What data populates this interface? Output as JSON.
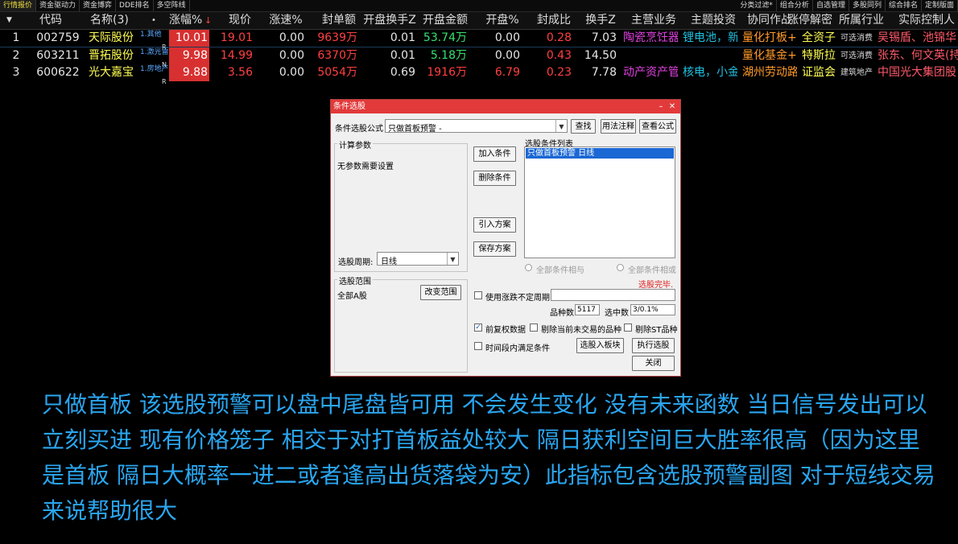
{
  "topbar": {
    "left_tabs": [
      "行情报价",
      "资金驱动力",
      "资金博弈",
      "DDE排名",
      "多空阵线"
    ],
    "right_tabs": [
      "分类过滤*",
      "组合分析",
      "自选管理",
      "多股同列",
      "综合排名",
      "定制版面"
    ]
  },
  "table": {
    "headers": {
      "idx": "▼",
      "code": "代码",
      "name": "名称(3)",
      "dot": "•",
      "chg": "涨幅%",
      "sort_arrow": "↓",
      "price": "现价",
      "speed": "涨速%",
      "seal": "封单额",
      "open_turn": "开盘换手Z",
      "open_amt": "开盘金额",
      "open_pct": "开盘%",
      "seal_ratio": "封成比",
      "turn": "换手Z",
      "business": "主营业务",
      "theme": "主题投资",
      "synergy": "协同作战",
      "reason": "涨停解密",
      "industry": "所属行业",
      "controller": "实际控制人"
    },
    "rows": [
      {
        "idx": "1",
        "code": "002759",
        "name": "天际股份",
        "tag": "1.其他",
        "N": "R",
        "chg": "10.01",
        "price": "19.01",
        "speed": "0.00",
        "seal": "9639万",
        "open_turn": "0.01",
        "open_amt": "53.74万",
        "open_pct": "0.00",
        "seal_ratio": "0.28",
        "turn": "7.03",
        "business": "陶瓷烹饪器",
        "theme": "锂电池，新",
        "synergy": "量化打板+",
        "reason": "全资子",
        "industry": "可选消费",
        "controller": "吴锡盾、池锦华"
      },
      {
        "idx": "2",
        "code": "603211",
        "name": "晋拓股份",
        "tag": "1.激光雷",
        "N": "N",
        "chg": "9.98",
        "price": "14.99",
        "speed": "0.00",
        "seal": "6370万",
        "open_turn": "0.01",
        "open_amt": "5.18万",
        "open_pct": "0.00",
        "seal_ratio": "0.43",
        "turn": "14.50",
        "business": "",
        "theme": "",
        "synergy": "量化基金+",
        "reason": "特斯拉",
        "industry": "可选消费",
        "controller": "张东、何文英(持"
      },
      {
        "idx": "3",
        "code": "600622",
        "name": "光大嘉宝",
        "tag": "1.房地产",
        "N": "R",
        "chg": "9.88",
        "price": "3.56",
        "speed": "0.00",
        "seal": "5054万",
        "open_turn": "0.69",
        "open_amt": "1916万",
        "open_pct": "6.79",
        "seal_ratio": "0.23",
        "turn": "7.78",
        "business": "动产资产管",
        "theme": "核电，小金",
        "synergy": "湖州劳动路",
        "reason": "证监会",
        "industry": "建筑地产",
        "controller": "中国光大集团股"
      }
    ]
  },
  "dialog": {
    "title": "条件选股",
    "formula_label": "条件选股公式",
    "formula_value": "只做首板预警 -",
    "find_button": "查找",
    "usage_button": "用法注释",
    "view_button": "查看公式",
    "params_group": "计算参数",
    "params_text": "无参数需要设置",
    "period_label": "选股周期:",
    "period_value": "日线",
    "add_button": "加入条件",
    "delete_button": "删除条件",
    "import_button": "引入方案",
    "save_button": "保存方案",
    "list_label": "选股条件列表",
    "list_item": "只做首板预警  日线",
    "and_label": "全部条件相与",
    "or_label": "全部条件相或",
    "done_status": "选股完毕.",
    "range_group": "选股范围",
    "range_value": "全部A股",
    "change_range_button": "改变范围",
    "use_period_label": "使用涨跌不定周期",
    "count_label": "品种数",
    "count_value": "5117",
    "selected_label": "选中数",
    "selected_value": "3/0.1%",
    "prerights_label": "前复权数据",
    "exclude_untraded_label": "剔除当前未交易的品种",
    "exclude_st_label": "剔除ST品种",
    "time_range_label": "时间段内满足条件",
    "to_block_button": "选股入板块",
    "execute_button": "执行选股",
    "close_button": "关闭"
  },
  "caption": "只做首板 该选股预警可以盘中尾盘皆可用  不会发生变化 没有未来函数 当日信号发出可以立刻买进 现有价格笼子 相交于对打首板益处较大 隔日获利空间巨大胜率很高（因为这里是首板 隔日大概率一进二或者逢高出货落袋为安）此指标包含选股预警副图 对于短线交易来说帮助很大"
}
